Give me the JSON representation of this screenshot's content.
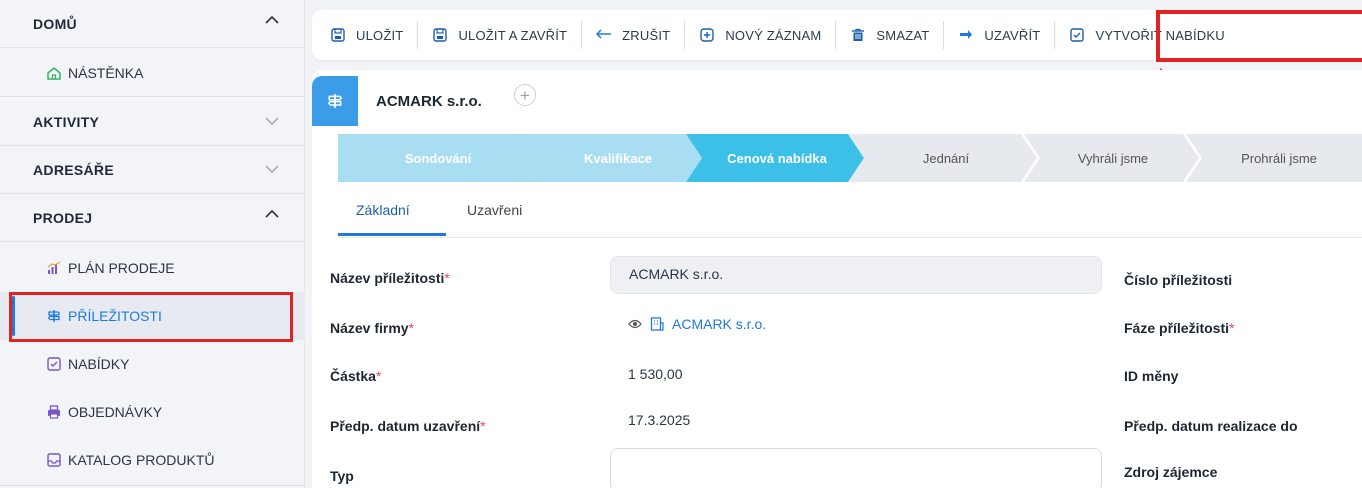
{
  "sidebar": {
    "sections": [
      {
        "label": "DOMŮ",
        "expanded": true
      },
      {
        "label": "AKTIVITY",
        "expanded": false
      },
      {
        "label": "ADRESÁŘE",
        "expanded": false
      },
      {
        "label": "PRODEJ",
        "expanded": true
      }
    ],
    "home_items": [
      {
        "label": "NÁSTĚNKA",
        "icon": "home-icon"
      }
    ],
    "sales_items": [
      {
        "label": "PLÁN PRODEJE",
        "icon": "chart-icon"
      },
      {
        "label": "PŘÍLEŽITOSTI",
        "icon": "signpost-icon",
        "active": true
      },
      {
        "label": "NABÍDKY",
        "icon": "offer-icon"
      },
      {
        "label": "OBJEDNÁVKY",
        "icon": "printer-icon"
      },
      {
        "label": "KATALOG PRODUKTŮ",
        "icon": "inbox-icon"
      }
    ]
  },
  "toolbar": {
    "save": "ULOŽIT",
    "save_close": "ULOŽIT A ZAVŘÍT",
    "cancel": "ZRUŠIT",
    "new_record": "NOVÝ ZÁZNAM",
    "delete": "SMAZAT",
    "close": "UZAVŘÍT",
    "create_offer": "VYTVOŘIT NABÍDKU"
  },
  "record": {
    "title": "ACMARK s.r.o.",
    "add": "+"
  },
  "stepper": [
    {
      "label": "Sondování",
      "state": "done"
    },
    {
      "label": "Kvalifikace",
      "state": "done"
    },
    {
      "label": "Cenová nabídka",
      "state": "current"
    },
    {
      "label": "Jednání",
      "state": "todo"
    },
    {
      "label": "Vyhráli jsme",
      "state": "todo"
    },
    {
      "label": "Prohráli jsme",
      "state": "todo"
    }
  ],
  "tabs": [
    {
      "label": "Základní",
      "active": true
    },
    {
      "label": "Uzavřeni",
      "active": false
    }
  ],
  "form": {
    "required_mark": "*",
    "left": [
      {
        "label": "Název příležitosti",
        "required": true,
        "value": "ACMARK s.r.o."
      },
      {
        "label": "Název firmy",
        "required": true,
        "value": "ACMARK s.r.o."
      },
      {
        "label": "Částka",
        "required": true,
        "value": "1 530,00"
      },
      {
        "label": "Předp. datum uzavření",
        "required": true,
        "value": "17.3.2025"
      },
      {
        "label": "Typ",
        "required": false,
        "value": ""
      }
    ],
    "right": [
      {
        "label": "Číslo příležitosti",
        "required": false
      },
      {
        "label": "Fáze příležitosti",
        "required": true
      },
      {
        "label": "ID měny",
        "required": false
      },
      {
        "label": "Předp. datum realizace do",
        "required": false
      },
      {
        "label": "Zdroj zájemce",
        "required": false
      }
    ]
  },
  "colors": {
    "accent": "#1f7ae0",
    "step_done": "#a9def2",
    "step_current": "#3cc0e8",
    "step_todo": "#e6e9ee",
    "highlight": "#e02424",
    "required": "#e34848"
  }
}
